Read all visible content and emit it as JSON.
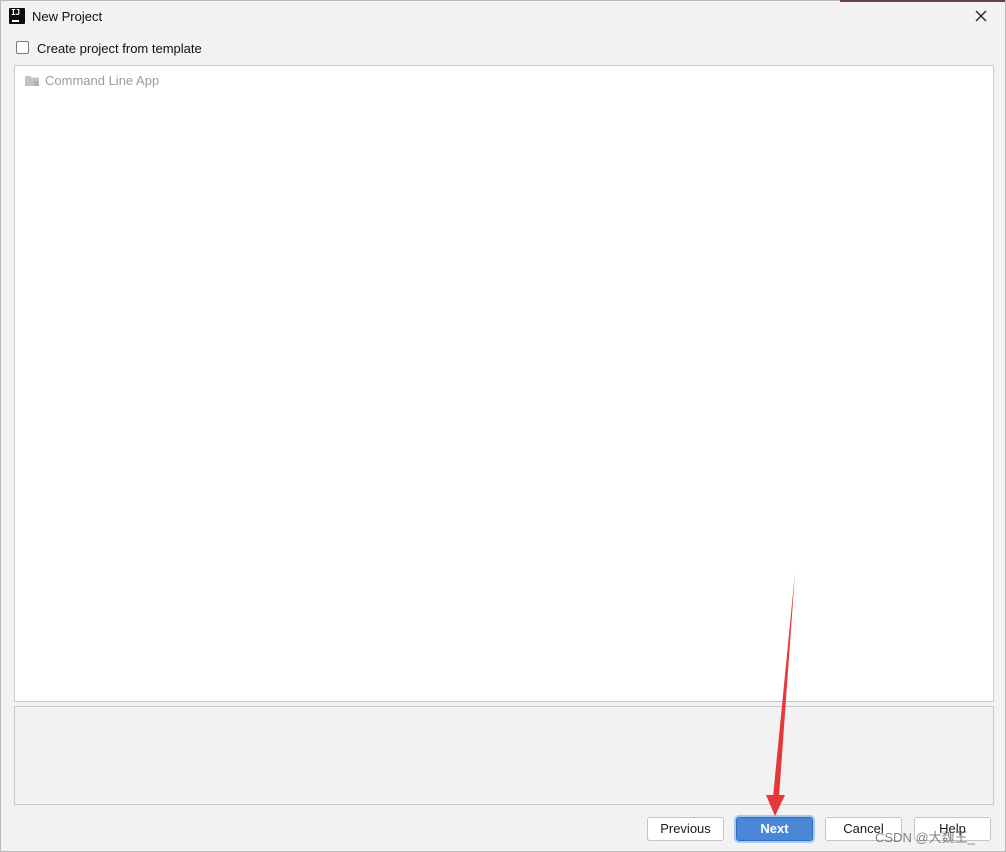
{
  "window": {
    "title": "New Project",
    "app_icon": "intellij-idea-icon",
    "close_icon": "close-icon"
  },
  "template_option": {
    "label": "Create project from template",
    "checked": false
  },
  "template_list": {
    "items": [
      {
        "label": "Command Line App",
        "icon": "folder-icon",
        "enabled": false
      }
    ]
  },
  "buttons": {
    "previous": "Previous",
    "next": "Next",
    "cancel": "Cancel",
    "help": "Help"
  },
  "annotation": {
    "arrow_color": "#e8373a",
    "points_to": "next-button"
  },
  "watermark": "CSDN @大魏王_",
  "colors": {
    "primary_button": "#4a87d4",
    "dialog_background": "#f2f2f2",
    "disabled_text": "#9c9c9c"
  }
}
